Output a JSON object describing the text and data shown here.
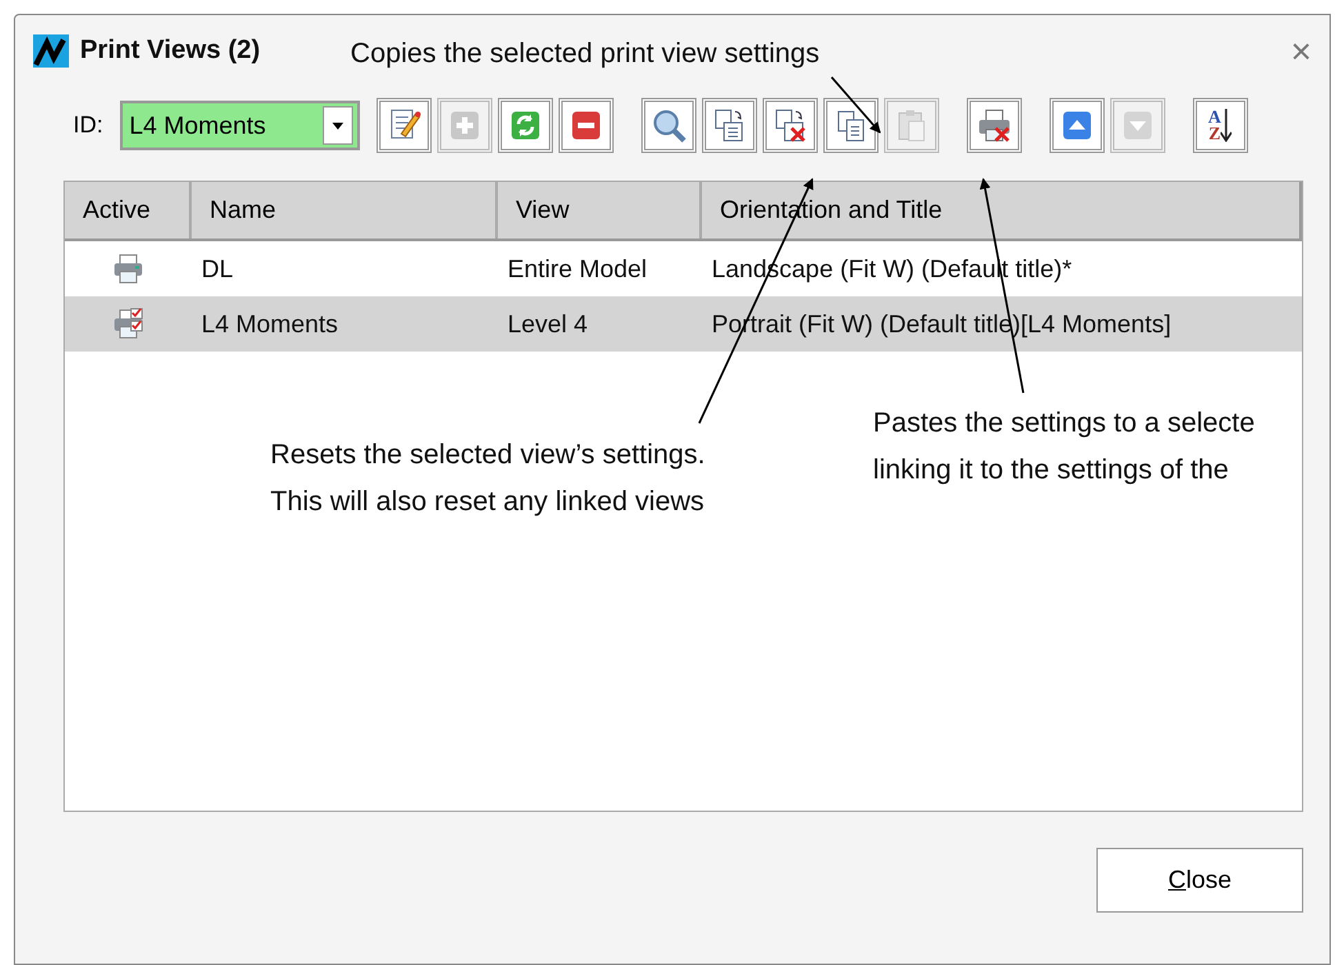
{
  "window": {
    "title": "Print Views (2)",
    "close": "×"
  },
  "id_field": {
    "label": "ID:",
    "value": "L4 Moments"
  },
  "toolbar": [
    [
      {
        "kind": "edit",
        "disabled": false
      },
      {
        "kind": "add",
        "disabled": true
      },
      {
        "kind": "refresh",
        "disabled": false
      },
      {
        "kind": "delete",
        "disabled": false
      }
    ],
    [
      {
        "kind": "search",
        "disabled": false
      },
      {
        "kind": "copy-to",
        "disabled": false
      },
      {
        "kind": "reset",
        "disabled": false
      },
      {
        "kind": "copy",
        "disabled": false
      },
      {
        "kind": "paste",
        "disabled": true
      }
    ],
    [
      {
        "kind": "print-off",
        "disabled": false
      }
    ],
    [
      {
        "kind": "up",
        "disabled": false
      },
      {
        "kind": "down",
        "disabled": true
      }
    ],
    [
      {
        "kind": "sort",
        "disabled": false,
        "letters": [
          "A",
          "Z"
        ]
      }
    ]
  ],
  "table": {
    "columns": [
      "Active",
      "Name",
      "View",
      "Orientation and Title"
    ],
    "rows": [
      {
        "selected": false,
        "kind": "printer",
        "name": "DL",
        "view": "Entire Model",
        "orientation": "Landscape (Fit W) (Default title)*"
      },
      {
        "selected": true,
        "kind": "printer-linked",
        "name": "L4 Moments",
        "view": "Level 4",
        "orientation": "Portrait (Fit W) (Default title)[L4 Moments]"
      }
    ]
  },
  "close_button": {
    "label": "Close",
    "access_key_underlined": true
  },
  "annotations": [
    {
      "lines": [
        "Copies the selected print view settings"
      ]
    },
    {
      "lines": [
        "Resets the selected view’s settings.",
        "This will also reset any linked views"
      ]
    },
    {
      "lines": [
        "Pastes the settings to a selecte",
        "linking it to the settings of the"
      ]
    }
  ]
}
